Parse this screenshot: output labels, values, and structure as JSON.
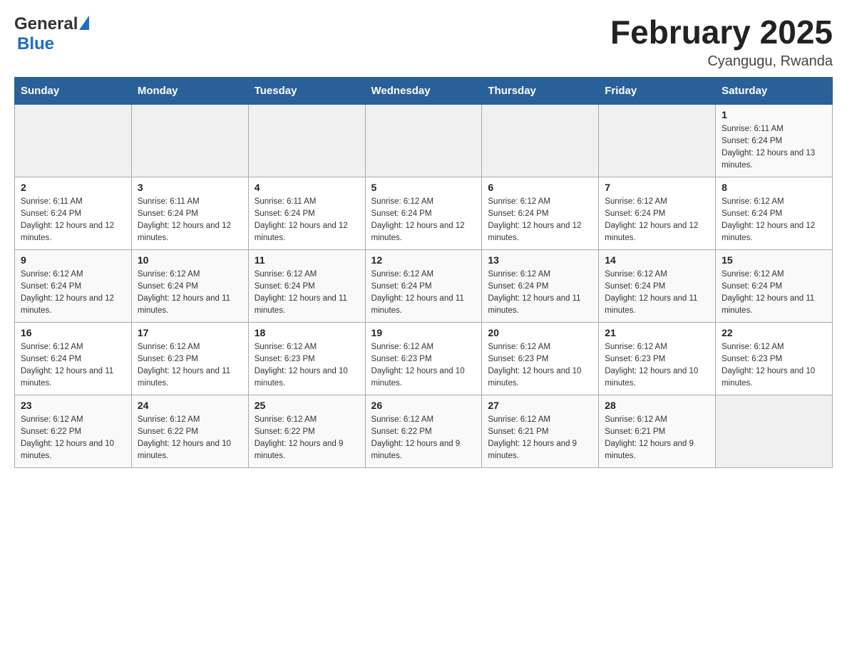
{
  "header": {
    "logo_general": "General",
    "logo_blue": "Blue",
    "month_title": "February 2025",
    "location": "Cyangugu, Rwanda"
  },
  "weekdays": [
    "Sunday",
    "Monday",
    "Tuesday",
    "Wednesday",
    "Thursday",
    "Friday",
    "Saturday"
  ],
  "weeks": [
    [
      {
        "day": "",
        "info": ""
      },
      {
        "day": "",
        "info": ""
      },
      {
        "day": "",
        "info": ""
      },
      {
        "day": "",
        "info": ""
      },
      {
        "day": "",
        "info": ""
      },
      {
        "day": "",
        "info": ""
      },
      {
        "day": "1",
        "info": "Sunrise: 6:11 AM\nSunset: 6:24 PM\nDaylight: 12 hours and 13 minutes."
      }
    ],
    [
      {
        "day": "2",
        "info": "Sunrise: 6:11 AM\nSunset: 6:24 PM\nDaylight: 12 hours and 12 minutes."
      },
      {
        "day": "3",
        "info": "Sunrise: 6:11 AM\nSunset: 6:24 PM\nDaylight: 12 hours and 12 minutes."
      },
      {
        "day": "4",
        "info": "Sunrise: 6:11 AM\nSunset: 6:24 PM\nDaylight: 12 hours and 12 minutes."
      },
      {
        "day": "5",
        "info": "Sunrise: 6:12 AM\nSunset: 6:24 PM\nDaylight: 12 hours and 12 minutes."
      },
      {
        "day": "6",
        "info": "Sunrise: 6:12 AM\nSunset: 6:24 PM\nDaylight: 12 hours and 12 minutes."
      },
      {
        "day": "7",
        "info": "Sunrise: 6:12 AM\nSunset: 6:24 PM\nDaylight: 12 hours and 12 minutes."
      },
      {
        "day": "8",
        "info": "Sunrise: 6:12 AM\nSunset: 6:24 PM\nDaylight: 12 hours and 12 minutes."
      }
    ],
    [
      {
        "day": "9",
        "info": "Sunrise: 6:12 AM\nSunset: 6:24 PM\nDaylight: 12 hours and 12 minutes."
      },
      {
        "day": "10",
        "info": "Sunrise: 6:12 AM\nSunset: 6:24 PM\nDaylight: 12 hours and 11 minutes."
      },
      {
        "day": "11",
        "info": "Sunrise: 6:12 AM\nSunset: 6:24 PM\nDaylight: 12 hours and 11 minutes."
      },
      {
        "day": "12",
        "info": "Sunrise: 6:12 AM\nSunset: 6:24 PM\nDaylight: 12 hours and 11 minutes."
      },
      {
        "day": "13",
        "info": "Sunrise: 6:12 AM\nSunset: 6:24 PM\nDaylight: 12 hours and 11 minutes."
      },
      {
        "day": "14",
        "info": "Sunrise: 6:12 AM\nSunset: 6:24 PM\nDaylight: 12 hours and 11 minutes."
      },
      {
        "day": "15",
        "info": "Sunrise: 6:12 AM\nSunset: 6:24 PM\nDaylight: 12 hours and 11 minutes."
      }
    ],
    [
      {
        "day": "16",
        "info": "Sunrise: 6:12 AM\nSunset: 6:24 PM\nDaylight: 12 hours and 11 minutes."
      },
      {
        "day": "17",
        "info": "Sunrise: 6:12 AM\nSunset: 6:23 PM\nDaylight: 12 hours and 11 minutes."
      },
      {
        "day": "18",
        "info": "Sunrise: 6:12 AM\nSunset: 6:23 PM\nDaylight: 12 hours and 10 minutes."
      },
      {
        "day": "19",
        "info": "Sunrise: 6:12 AM\nSunset: 6:23 PM\nDaylight: 12 hours and 10 minutes."
      },
      {
        "day": "20",
        "info": "Sunrise: 6:12 AM\nSunset: 6:23 PM\nDaylight: 12 hours and 10 minutes."
      },
      {
        "day": "21",
        "info": "Sunrise: 6:12 AM\nSunset: 6:23 PM\nDaylight: 12 hours and 10 minutes."
      },
      {
        "day": "22",
        "info": "Sunrise: 6:12 AM\nSunset: 6:23 PM\nDaylight: 12 hours and 10 minutes."
      }
    ],
    [
      {
        "day": "23",
        "info": "Sunrise: 6:12 AM\nSunset: 6:22 PM\nDaylight: 12 hours and 10 minutes."
      },
      {
        "day": "24",
        "info": "Sunrise: 6:12 AM\nSunset: 6:22 PM\nDaylight: 12 hours and 10 minutes."
      },
      {
        "day": "25",
        "info": "Sunrise: 6:12 AM\nSunset: 6:22 PM\nDaylight: 12 hours and 9 minutes."
      },
      {
        "day": "26",
        "info": "Sunrise: 6:12 AM\nSunset: 6:22 PM\nDaylight: 12 hours and 9 minutes."
      },
      {
        "day": "27",
        "info": "Sunrise: 6:12 AM\nSunset: 6:21 PM\nDaylight: 12 hours and 9 minutes."
      },
      {
        "day": "28",
        "info": "Sunrise: 6:12 AM\nSunset: 6:21 PM\nDaylight: 12 hours and 9 minutes."
      },
      {
        "day": "",
        "info": ""
      }
    ]
  ]
}
